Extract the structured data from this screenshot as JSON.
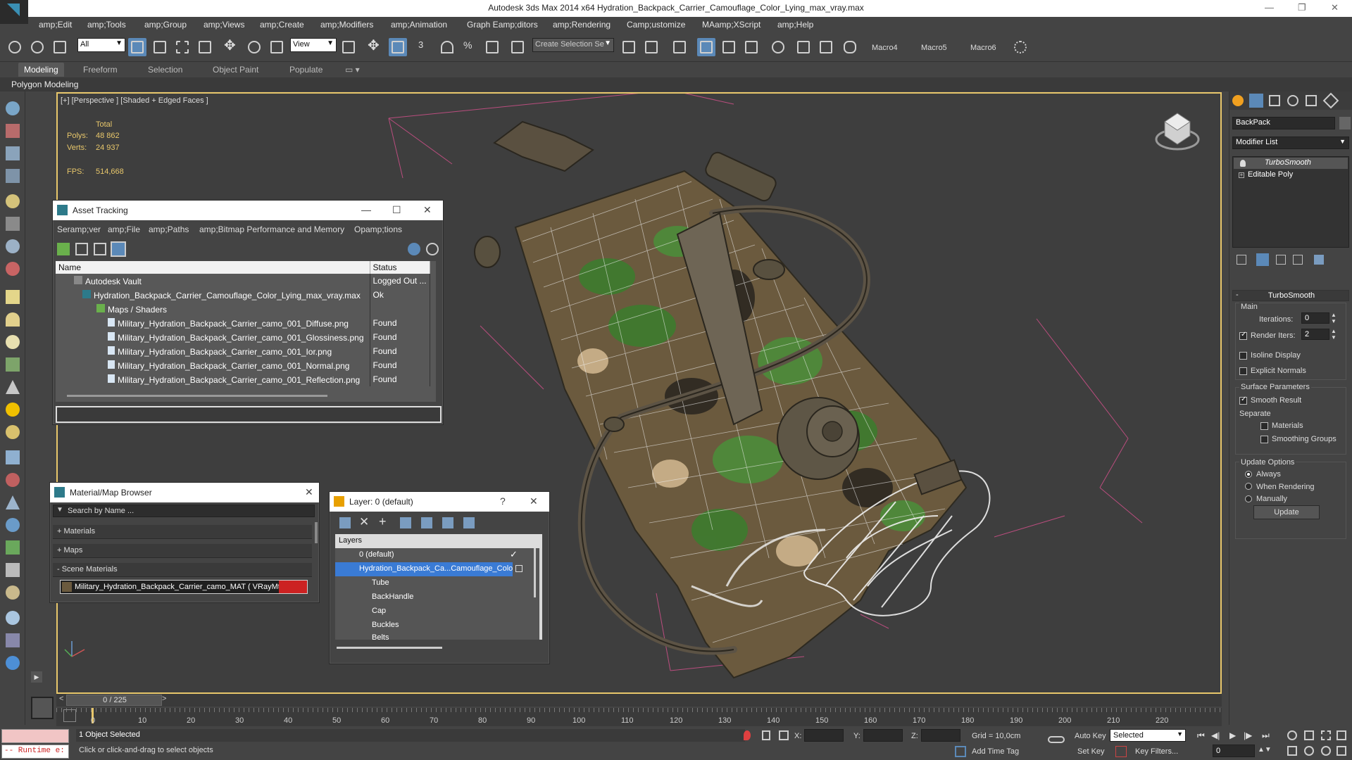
{
  "window": {
    "title": "Autodesk 3ds Max  2014 x64     Hydration_Backpack_Carrier_Camouflage_Color_Lying_max_vray.max"
  },
  "menu": [
    "amp;Edit",
    "amp;Tools",
    "amp;Group",
    "amp;Views",
    "amp;Create",
    "amp;Modifiers",
    "amp;Animation",
    "Graph Eamp;ditors",
    "amp;Rendering",
    "Camp;ustomize",
    "MAamp;XScript",
    "amp;Help"
  ],
  "toolbar": {
    "filter_value": "All",
    "refcoord_value": "View",
    "selection_set_placeholder": "Create Selection Se",
    "macros": [
      "Macro4",
      "Macro5",
      "Macro6"
    ]
  },
  "ribbon": {
    "tabs": [
      "Modeling",
      "Freeform",
      "Selection",
      "Object Paint",
      "Populate"
    ],
    "active": "Modeling",
    "sub_label": "Polygon Modeling"
  },
  "viewport": {
    "label": "[+] [Perspective ] [Shaded + Edged Faces ]",
    "stats": {
      "total_label": "Total",
      "polys_label": "Polys:",
      "polys_value": "48 862",
      "verts_label": "Verts:",
      "verts_value": "24 937",
      "fps_label": "FPS:",
      "fps_value": "514,668"
    }
  },
  "asset_tracking": {
    "title": "Asset Tracking",
    "menu": [
      "Seramp;ver",
      "amp;File",
      "amp;Paths",
      "amp;Bitmap Performance and Memory",
      "Opamp;tions"
    ],
    "columns": [
      "Name",
      "Status"
    ],
    "rows": [
      {
        "name": "Autodesk Vault",
        "status": "Logged Out ..."
      },
      {
        "name": "Hydration_Backpack_Carrier_Camouflage_Color_Lying_max_vray.max",
        "status": "Ok"
      },
      {
        "name": "Maps / Shaders",
        "status": ""
      },
      {
        "name": "Military_Hydration_Backpack_Carrier_camo_001_Diffuse.png",
        "status": "Found"
      },
      {
        "name": "Military_Hydration_Backpack_Carrier_camo_001_Glossiness.png",
        "status": "Found"
      },
      {
        "name": "Military_Hydration_Backpack_Carrier_camo_001_Ior.png",
        "status": "Found"
      },
      {
        "name": "Military_Hydration_Backpack_Carrier_camo_001_Normal.png",
        "status": "Found"
      },
      {
        "name": "Military_Hydration_Backpack_Carrier_camo_001_Reflection.png",
        "status": "Found"
      }
    ]
  },
  "material_browser": {
    "title": "Material/Map Browser",
    "search_placeholder": "Search by Name ...",
    "sections": [
      "+ Materials",
      "+ Maps",
      "- Scene Materials"
    ],
    "material": "Military_Hydration_Backpack_Carrier_camo_MAT ( VRayMtl ) ..."
  },
  "layer_dialog": {
    "title": "Layer: 0 (default)",
    "header": "Layers",
    "items": [
      "0 (default)",
      "Hydration_Backpack_Ca...Camouflage_Color",
      "Tube",
      "BackHandle",
      "Cap",
      "Buckles",
      "Belts"
    ]
  },
  "command_panel": {
    "object_name": "BackPack",
    "modifier_list": "Modifier List",
    "stack": [
      "TurboSmooth",
      "Editable Poly"
    ],
    "rollout_title": "TurboSmooth",
    "main_label": "Main",
    "iterations_label": "Iterations:",
    "iterations_value": "0",
    "render_iters_label": "Render Iters:",
    "render_iters_value": "2",
    "isoline_label": "Isoline Display",
    "explicit_label": "Explicit Normals",
    "surface_label": "Surface Parameters",
    "smooth_result_label": "Smooth Result",
    "separate_label": "Separate",
    "materials_label": "Materials",
    "smoothing_groups_label": "Smoothing Groups",
    "update_options_label": "Update Options",
    "always_label": "Always",
    "when_rendering_label": "When Rendering",
    "manually_label": "Manually",
    "update_button": "Update"
  },
  "timeline": {
    "frame_indicator": "0 / 225",
    "ticks": [
      "0",
      "10",
      "20",
      "30",
      "40",
      "50",
      "60",
      "70",
      "80",
      "90",
      "100",
      "110",
      "120",
      "130",
      "140",
      "150",
      "160",
      "170",
      "180",
      "190",
      "200",
      "210",
      "220"
    ]
  },
  "status": {
    "script_listener": "-- Runtime e:",
    "selected_text": "1 Object Selected",
    "prompt": "Click or click-and-drag to select objects",
    "x_label": "X:",
    "y_label": "Y:",
    "z_label": "Z:",
    "grid": "Grid = 10,0cm",
    "add_time_tag": "Add Time Tag",
    "auto_key": "Auto Key",
    "set_key": "Set Key",
    "selected_dropdown": "Selected",
    "key_filters": "Key Filters...",
    "frame_value": "0"
  }
}
